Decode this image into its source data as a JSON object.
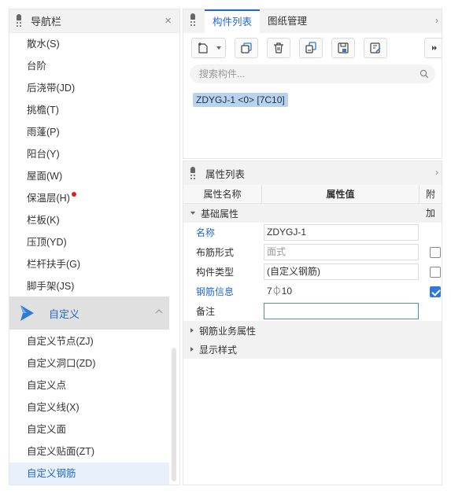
{
  "nav": {
    "title": "导航栏",
    "items": [
      {
        "label": "散水(S)"
      },
      {
        "label": "台阶"
      },
      {
        "label": "后浇带(JD)"
      },
      {
        "label": "挑檐(T)"
      },
      {
        "label": "雨蓬(P)"
      },
      {
        "label": "阳台(Y)"
      },
      {
        "label": "屋面(W)"
      },
      {
        "label": "保温层(H)"
      },
      {
        "label": "栏板(K)"
      },
      {
        "label": "压顶(YD)"
      },
      {
        "label": "栏杆扶手(G)"
      },
      {
        "label": "脚手架(JS)"
      }
    ],
    "group": {
      "label": "自定义",
      "icon": "custom-play-icon",
      "expanded": true
    },
    "sub_items": [
      {
        "label": "自定义节点(ZJ)"
      },
      {
        "label": "自定义洞口(ZD)"
      },
      {
        "label": "自定义点"
      },
      {
        "label": "自定义线(X)"
      },
      {
        "label": "自定义面"
      },
      {
        "label": "自定义贴面(ZT)"
      },
      {
        "label": "自定义钢筋"
      }
    ],
    "active_sub": "自定义钢筋",
    "badge_color": "#e02020",
    "accent": "#2468cc"
  },
  "component_panel": {
    "tabs": [
      {
        "label": "构件列表",
        "active": true
      },
      {
        "label": "图纸管理",
        "active": false
      }
    ],
    "toolbar": [
      "new-icon",
      "copy-icon",
      "delete-icon",
      "layer-copy-icon",
      "save-icon",
      "edit-icon"
    ],
    "search": {
      "placeholder": "搜索构件...",
      "value": ""
    },
    "selected_component": "ZDYGJ-1 <0> [7C10]"
  },
  "property_panel": {
    "title": "属性列表",
    "columns": {
      "name": "属性名称",
      "value": "属性值",
      "add": "附加"
    },
    "groups": [
      {
        "label": "基础属性",
        "expanded": true,
        "rows": [
          {
            "name": "名称",
            "value": "ZDYGJ-1",
            "link": true,
            "checkbox": null
          },
          {
            "name": "布筋形式",
            "value": "",
            "placeholder": "面式",
            "link": false,
            "checkbox": false
          },
          {
            "name": "构件类型",
            "value": "(自定义钢筋)",
            "link": false,
            "checkbox": false
          },
          {
            "name": "钢筋信息",
            "value": "7⏀10",
            "link": true,
            "checkbox": true
          },
          {
            "name": "备注",
            "value": "",
            "link": false,
            "checkbox": null,
            "focused": true
          }
        ]
      },
      {
        "label": "钢筋业务属性",
        "expanded": false
      },
      {
        "label": "显示样式",
        "expanded": false
      }
    ]
  }
}
